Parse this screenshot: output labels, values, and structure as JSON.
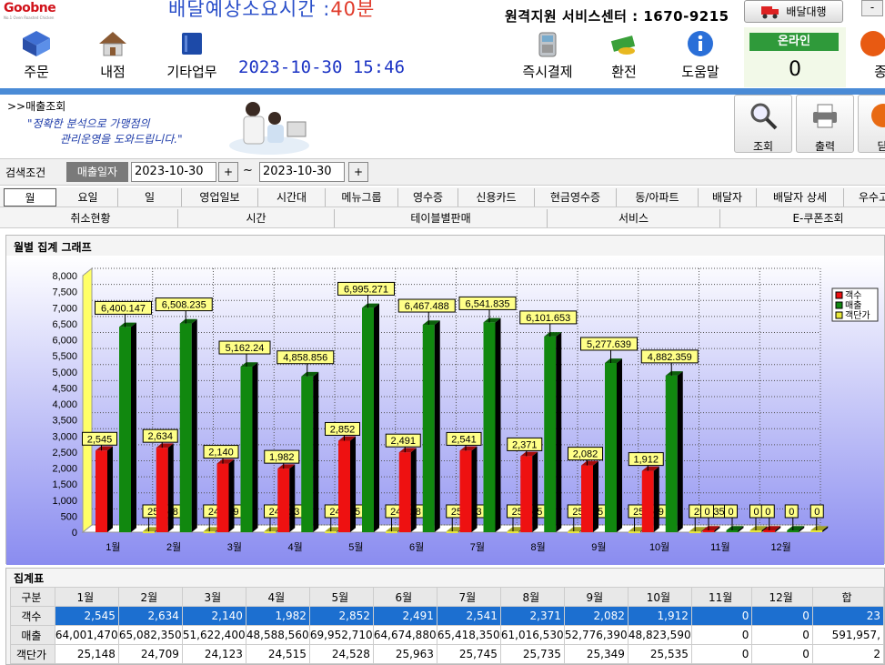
{
  "brand": {
    "logo": "Goobne",
    "logo_tag": "No.1 Oven Roasted Chicken"
  },
  "header": {
    "delivery_time_label": "배달예상소요시간 :",
    "delivery_time_value": "40분",
    "service_center": "원격지원 서비스센터 : 1670-9215",
    "delivery_agent_button": "배달대행",
    "datetime": "2023-10-30 15:46"
  },
  "toolbar": {
    "items_left": [
      {
        "label": "주문",
        "icon": "order-icon"
      },
      {
        "label": "내점",
        "icon": "house-icon"
      },
      {
        "label": "기타업무",
        "icon": "book-icon"
      }
    ],
    "items_right": [
      {
        "label": "즉시결제",
        "icon": "card-terminal-icon"
      },
      {
        "label": "환전",
        "icon": "money-icon"
      },
      {
        "label": "도움말",
        "icon": "info-icon"
      }
    ],
    "online_label": "온라인",
    "online_count": "0",
    "cut_label": "종"
  },
  "subheader": {
    "breadcrumb": ">>매출조회",
    "slogan_line1": "\"정확한 분석으로 가맹점의",
    "slogan_line2": "관리운영을 도와드립니다.\"",
    "actions": [
      {
        "label": "조회",
        "icon": "magnifier-icon"
      },
      {
        "label": "출력",
        "icon": "printer-icon"
      },
      {
        "label": "닫",
        "icon": "close-icon"
      }
    ]
  },
  "search": {
    "label": "검색조건",
    "date_type_button": "매출일자",
    "date_from": "2023-10-30",
    "date_to": "2023-10-30",
    "plus": "+",
    "tilde": "~"
  },
  "tabs_row1": [
    "월",
    "요일",
    "일",
    "영업일보",
    "시간대",
    "메뉴그룹",
    "영수증",
    "신용카드",
    "현금영수증",
    "동/아파트",
    "배달자",
    "배달자 상세",
    "우수고"
  ],
  "tabs_row2": [
    "취소현황",
    "시간",
    "테이블별판매",
    "서비스",
    "E-쿠폰조회"
  ],
  "chart_panel_title": "월별 집계 그래프",
  "table_panel_title": "집계표",
  "chart_data": {
    "type": "bar",
    "categories": [
      "1월",
      "2월",
      "3월",
      "4월",
      "5월",
      "6월",
      "7월",
      "8월",
      "9월",
      "10월",
      "11월",
      "12월"
    ],
    "ylim": [
      0,
      8000
    ],
    "yticks": [
      "0",
      "500",
      "1,000",
      "1,500",
      "2,000",
      "2,500",
      "3,000",
      "3,500",
      "4,000",
      "4,500",
      "5,000",
      "5,500",
      "6,000",
      "6,500",
      "7,000",
      "7,500",
      "8,000"
    ],
    "legend_position": "right",
    "series": [
      {
        "name": "객수",
        "color": "#ee1111",
        "values": [
          2545,
          2634,
          2140,
          1982,
          2852,
          2491,
          2541,
          2371,
          2082,
          1912,
          0,
          0
        ],
        "labels": [
          "2,545",
          "2,634",
          "2,140",
          "1,982",
          "2,852",
          "2,491",
          "2,541",
          "2,371",
          "2,082",
          "1,912",
          "0",
          "0"
        ]
      },
      {
        "name": "매출",
        "color": "#11880f",
        "values": [
          6400.147,
          6508.235,
          5162.24,
          4858.856,
          6995.271,
          6467.488,
          6541.835,
          6101.653,
          5277.639,
          4882.359,
          0,
          0
        ],
        "labels": [
          "6,400.147",
          "6,508.235",
          "5,162.24",
          "4,858.856",
          "6,995.271",
          "6,467.488",
          "6,541.835",
          "6,101.653",
          "5,277.639",
          "4,882.359",
          "0",
          "0"
        ]
      },
      {
        "name": "객단가",
        "color": "#e8e83a",
        "values": [
          25.148,
          24.709,
          24.123,
          24.515,
          24.528,
          25.963,
          25.745,
          25.735,
          25.349,
          25.535,
          0,
          0
        ],
        "labels": [
          "25.148",
          "24.709",
          "24.123",
          "24.515",
          "24.528",
          "25.963",
          "25.745",
          "25.735",
          "25.349",
          "25.535",
          "0",
          "0"
        ]
      }
    ]
  },
  "summary_table": {
    "header": [
      "구분",
      "1월",
      "2월",
      "3월",
      "4월",
      "5월",
      "6월",
      "7월",
      "8월",
      "9월",
      "10월",
      "11월",
      "12월",
      "합"
    ],
    "rows": [
      {
        "label": "객수",
        "values": [
          "2,545",
          "2,634",
          "2,140",
          "1,982",
          "2,852",
          "2,491",
          "2,541",
          "2,371",
          "2,082",
          "1,912",
          "0",
          "0",
          "23"
        ]
      },
      {
        "label": "매출",
        "values": [
          "64,001,470",
          "65,082,350",
          "51,622,400",
          "48,588,560",
          "69,952,710",
          "64,674,880",
          "65,418,350",
          "61,016,530",
          "52,776,390",
          "48,823,590",
          "0",
          "0",
          "591,957,"
        ]
      },
      {
        "label": "객단가",
        "values": [
          "25,148",
          "24,709",
          "24,123",
          "24,515",
          "24,528",
          "25,963",
          "25,745",
          "25,735",
          "25,349",
          "25,535",
          "0",
          "0",
          "2"
        ]
      }
    ]
  }
}
